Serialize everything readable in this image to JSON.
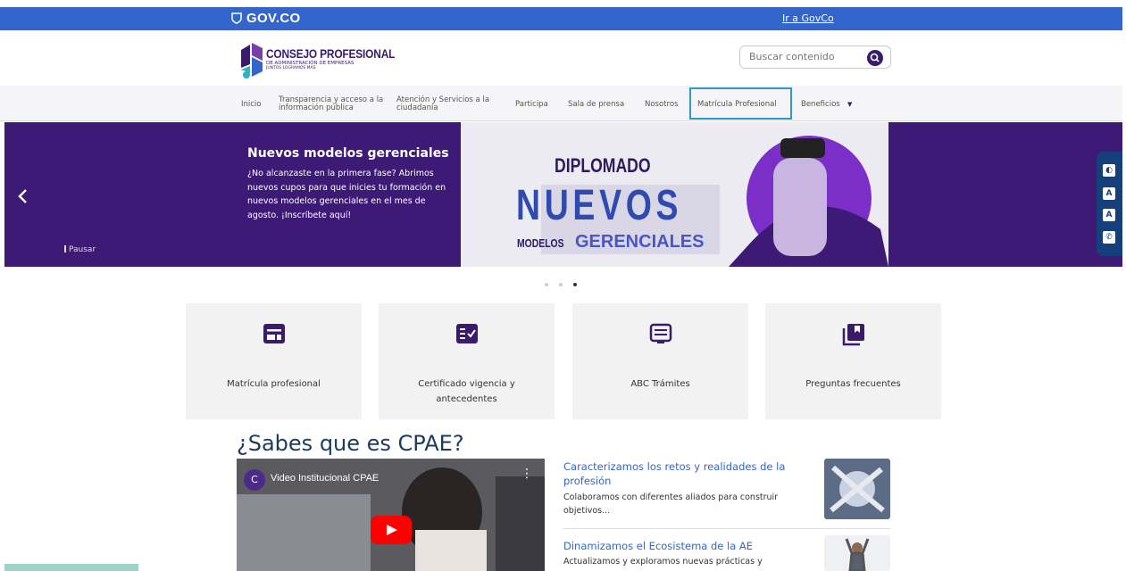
{
  "govbar": {
    "brand": "GOV.CO",
    "link": "Ir a GovCo"
  },
  "logo": {
    "line1": "CONSEJO PROFESIONAL",
    "line2": "DE ADMINISTRACIÓN DE EMPRESAS",
    "line3": "JUNTOS LOGRAMOS MÁS"
  },
  "search": {
    "placeholder": "Buscar contenido"
  },
  "nav": {
    "items": [
      {
        "label": "Inicio"
      },
      {
        "label": "Transparencia y acceso a la información pública"
      },
      {
        "label": "Atención y Servicios a la ciudadanía"
      },
      {
        "label": "Participa"
      },
      {
        "label": "Sala de prensa"
      },
      {
        "label": "Nosotros"
      },
      {
        "label": "Matrícula Profesional"
      },
      {
        "label": "Beneficios"
      }
    ],
    "dropdown_icon": "▼"
  },
  "hero": {
    "title": "Nuevos modelos gerenciales",
    "body": "¿No alcanzaste en la primera fase? Abrimos nuevos cupos para que inicies tu formación en nuevos modelos gerenciales en el mes de agosto. ¡Inscríbete aquí!",
    "pause": "Pausar",
    "image_word1": "DIPLOMADO",
    "image_word2": "NUEVOS",
    "image_word3a": "MODELOS",
    "image_word3b": "GERENCIALES",
    "active_slide": 3,
    "slide_count": 3
  },
  "cards": [
    {
      "label": "Matrícula profesional",
      "icon": "card-list-icon"
    },
    {
      "label": "Certificado vigencia y antecedentes",
      "icon": "checklist-icon"
    },
    {
      "label": "ABC Trámites",
      "icon": "document-lines-icon"
    },
    {
      "label": "Preguntas frecuentes",
      "icon": "bookmark-stack-icon"
    }
  ],
  "section": {
    "title": "¿Sabes que es CPAE?"
  },
  "video": {
    "title": "Video Institucional CPAE",
    "channel_letter": "C"
  },
  "news": [
    {
      "title": "Caracterizamos los retos y realidades de la profesión",
      "body": "Colaboramos con diferentes aliados para construir objetivos..."
    },
    {
      "title": "Dinamizamos el Ecosistema de la AE",
      "body": "Actualizamos y exploramos nuevas prácticas y"
    }
  ],
  "colors": {
    "govbar": "#3366cc",
    "brand_purple": "#3d1a76",
    "highlight": "#2e9bc6",
    "access_bar": "#153f7b"
  }
}
